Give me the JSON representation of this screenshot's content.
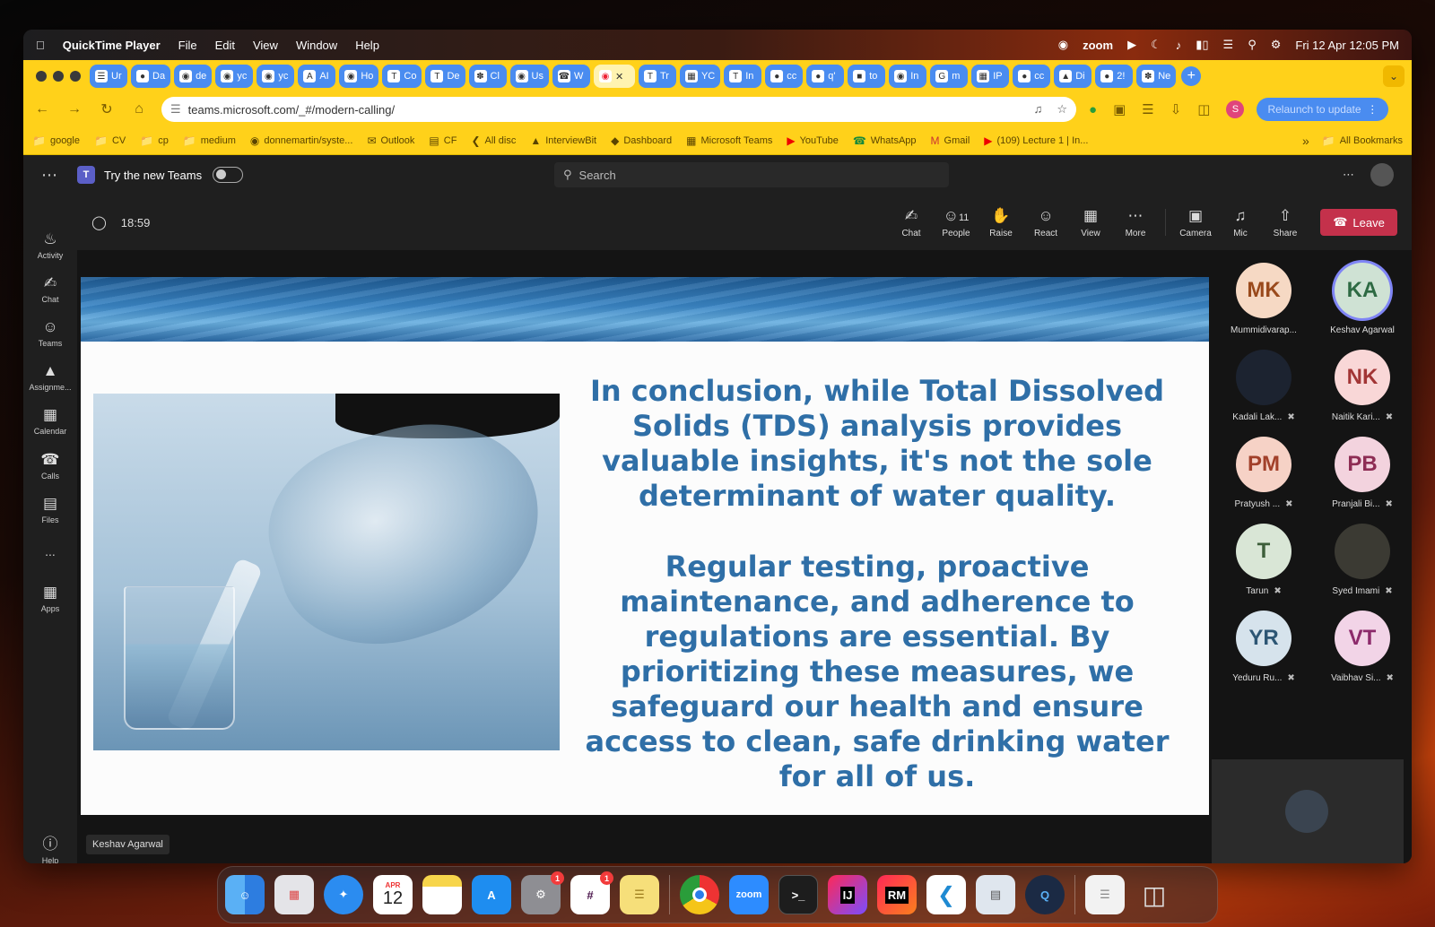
{
  "menubar": {
    "app_name": "QuickTime Player",
    "menus": [
      "File",
      "Edit",
      "View",
      "Window",
      "Help"
    ],
    "zoom_label": "zoom",
    "clock": "Fri 12 Apr  12:05 PM"
  },
  "browser": {
    "tabs": [
      "Ur",
      "Da",
      "de",
      "yc",
      "yc",
      "AI",
      "Ho",
      "Co",
      "De",
      "Cl",
      "Us",
      "W",
      "",
      "Tr",
      "YC",
      "In",
      "cc",
      "q'",
      "to",
      "In",
      "m",
      "IP",
      "cc",
      "Di",
      "2!",
      "Ne"
    ],
    "active_tab_index": 12,
    "url": "teams.microsoft.com/_#/modern-calling/",
    "relaunch_label": "Relaunch to update",
    "profile_initial": "S",
    "bookmarks": [
      "google",
      "CV",
      "cp",
      "medium",
      "donnemartin/syste...",
      "Outlook",
      "CF",
      "All disc",
      "InterviewBit",
      "Dashboard",
      "Microsoft Teams",
      "YouTube",
      "WhatsApp",
      "Gmail",
      "(109) Lecture 1 | In..."
    ],
    "all_bookmarks": "All Bookmarks"
  },
  "teams": {
    "try_new": "Try the new Teams",
    "search_placeholder": "Search",
    "rail": [
      "Activity",
      "Chat",
      "Teams",
      "Assignme...",
      "Calendar",
      "Calls",
      "Files",
      "...",
      "Apps"
    ],
    "help": "Help"
  },
  "call": {
    "timer": "18:59",
    "controls": {
      "chat": "Chat",
      "people": "People",
      "people_count": "11",
      "raise": "Raise",
      "react": "React",
      "view": "View",
      "more": "More",
      "camera": "Camera",
      "mic": "Mic",
      "share": "Share",
      "leave": "Leave"
    },
    "presenter": "Keshav Agarwal"
  },
  "slide": {
    "paragraph1": "In conclusion, while Total Dissolved Solids (TDS) analysis provides valuable insights, it's not the sole determinant of water quality.",
    "paragraph2": "Regular testing, proactive maintenance, and adherence to regulations are essential. By prioritizing these measures, we safeguard our health and ensure access to clean, safe drinking water for all of us."
  },
  "participants": [
    {
      "initials": "MK",
      "name": "Mummidivarap...",
      "bg": "#f6d9c4",
      "fg": "#9a4a1c",
      "muted": false
    },
    {
      "initials": "KA",
      "name": "Keshav Agarwal",
      "bg": "#cfe2d4",
      "fg": "#2e6a43",
      "muted": false
    },
    {
      "initials": "",
      "name": "Kadali Lak...",
      "bg": "#1c2330",
      "fg": "#fff",
      "muted": true
    },
    {
      "initials": "NK",
      "name": "Naitik Kari...",
      "bg": "#f9d7d7",
      "fg": "#a23535",
      "muted": true
    },
    {
      "initials": "PM",
      "name": "Pratyush ...",
      "bg": "#f6d2c6",
      "fg": "#a2402a",
      "muted": true
    },
    {
      "initials": "PB",
      "name": "Pranjali Bi...",
      "bg": "#f3d3de",
      "fg": "#8e2d54",
      "muted": true
    },
    {
      "initials": "T",
      "name": "Tarun",
      "bg": "#d9e6d6",
      "fg": "#3d5e3a",
      "muted": true
    },
    {
      "initials": "",
      "name": "Syed Imami",
      "bg": "#3b3a33",
      "fg": "#fff",
      "muted": true
    },
    {
      "initials": "YR",
      "name": "Yeduru Ru...",
      "bg": "#d6e3ec",
      "fg": "#2d5674",
      "muted": true
    },
    {
      "initials": "VT",
      "name": "Vaibhav Si...",
      "bg": "#f2d4e7",
      "fg": "#8c2a6b",
      "muted": true
    }
  ],
  "dock": {
    "calendar_month": "APR",
    "calendar_day": "12",
    "settings_badge": "1",
    "slack_badge": "1",
    "zoom_label": "zoom",
    "terminal_label": ">_",
    "intellij_label": "IJ",
    "rubymine_label": "RM"
  },
  "colors": {
    "accent_yellow": "#ffd11a",
    "teams_leave": "#c4314b",
    "slide_text": "#2f6fa7"
  }
}
